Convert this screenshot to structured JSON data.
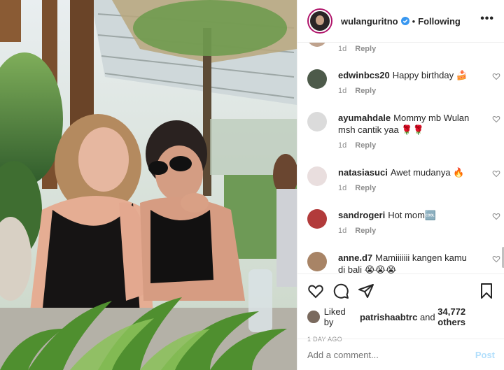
{
  "header": {
    "username": "wulanguritno",
    "separator": "•",
    "follow_state": "Following",
    "more_label": "•••"
  },
  "comments": [
    {
      "user": "",
      "text": "",
      "time": "1d",
      "reply": "Reply",
      "avatar_color": "#bfa28d"
    },
    {
      "user": "edwinbcs20",
      "text": "Happy birthday 🍰",
      "time": "1d",
      "reply": "Reply",
      "avatar_color": "#4d5a4a"
    },
    {
      "user": "ayumahdale",
      "text": "Mommy mb Wulan msh cantik yaa 🌹🌹",
      "time": "1d",
      "reply": "Reply",
      "avatar_color": "#dbdbdb"
    },
    {
      "user": "natasiasuci",
      "text": "Awet mudanya 🔥",
      "time": "1d",
      "reply": "Reply",
      "avatar_color": "#e9dede"
    },
    {
      "user": "sandrogeri",
      "text": "Hot mom🆒",
      "time": "1d",
      "reply": "Reply",
      "avatar_color": "#b23b3b"
    },
    {
      "user": "anne.d7",
      "text": "Mamiiiiiii kangen kamu di bali 😭😭😭",
      "time": "",
      "reply": "",
      "avatar_color": "#a88466"
    }
  ],
  "likes": {
    "prefix": "Liked by",
    "user": "patrishaabtrc",
    "middle": "and",
    "count": "34,772 others"
  },
  "date": "1 DAY AGO",
  "add_comment": {
    "placeholder": "Add a comment...",
    "post_label": "Post"
  },
  "colors": {
    "link_blue": "#0095f6",
    "post_disabled": "#b2dffc",
    "meta_gray": "#8e8e8e",
    "story_ring": "#b0146a"
  }
}
